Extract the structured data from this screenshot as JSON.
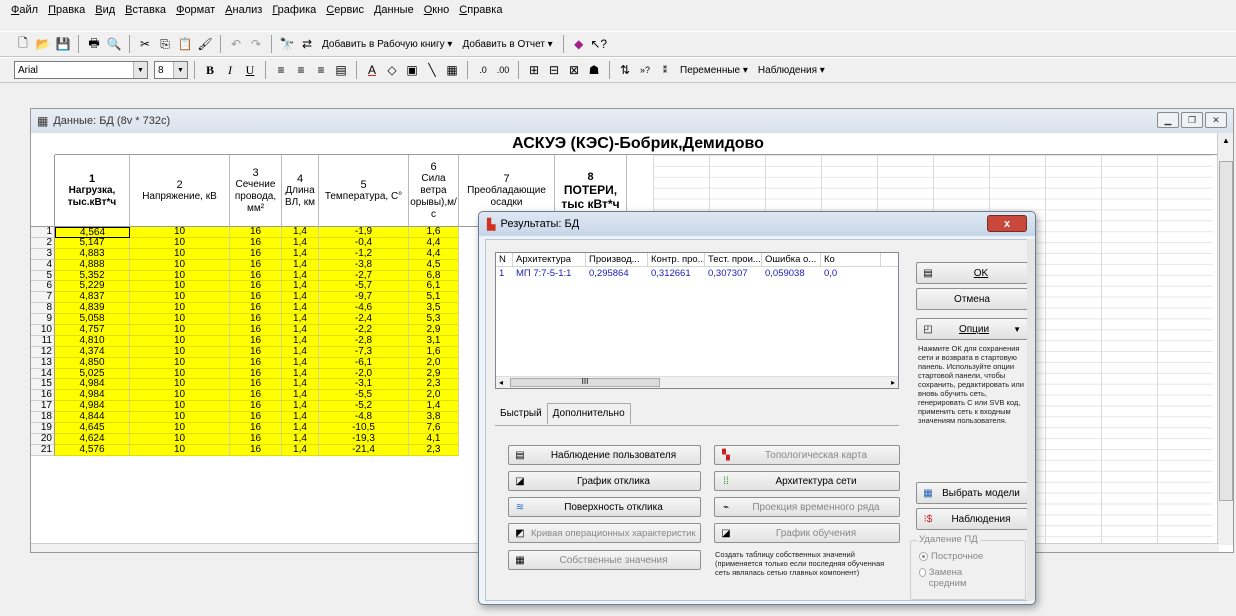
{
  "menu": [
    "Файл",
    "Правка",
    "Вид",
    "Вставка",
    "Формат",
    "Анализ",
    "Графика",
    "Сервис",
    "Данные",
    "Окно",
    "Справка"
  ],
  "toolbar1": {
    "add_workbook": "Добавить в Рабочую книгу ▾",
    "add_report": "Добавить в Отчет ▾"
  },
  "toolbar2": {
    "font": "Arial",
    "size": "8",
    "variables": "Переменные ▾",
    "observations": "Наблюдения ▾"
  },
  "data_window": {
    "title": "Данные: БД (8v * 732c)",
    "sheet_title": "АСКУЭ (КЭС)-Бобрик,Демидово",
    "columns": [
      {
        "num": "1",
        "label": "Нагрузка,\nтыс.кВт*ч",
        "bold": true
      },
      {
        "num": "2",
        "label": "Напряжение, кВ",
        "bold": false
      },
      {
        "num": "3",
        "label": "Сечение\nпровода,\nмм²",
        "bold": false
      },
      {
        "num": "4",
        "label": "Длина\nВЛ, км",
        "bold": false
      },
      {
        "num": "5",
        "label": "Температура, С°",
        "bold": false
      },
      {
        "num": "6",
        "label": "Сила\nветра\nорывы),м/с",
        "bold": false
      },
      {
        "num": "7",
        "label": "Преобладающие\nосадки",
        "bold": false
      },
      {
        "num": "8",
        "label": "ПОТЕРИ,\nтыс кВт*ч",
        "bold": true
      }
    ],
    "rows": [
      [
        "1",
        "4,564",
        "10",
        "16",
        "1,4",
        "-1,9",
        "1,6"
      ],
      [
        "2",
        "5,147",
        "10",
        "16",
        "1,4",
        "-0,4",
        "4,4"
      ],
      [
        "3",
        "4,883",
        "10",
        "16",
        "1,4",
        "-1,2",
        "4,4"
      ],
      [
        "4",
        "4,888",
        "10",
        "16",
        "1,4",
        "-3,8",
        "4,5"
      ],
      [
        "5",
        "5,352",
        "10",
        "16",
        "1,4",
        "-2,7",
        "6,8"
      ],
      [
        "6",
        "5,229",
        "10",
        "16",
        "1,4",
        "-5,7",
        "6,1"
      ],
      [
        "7",
        "4,837",
        "10",
        "16",
        "1,4",
        "-9,7",
        "5,1"
      ],
      [
        "8",
        "4,839",
        "10",
        "16",
        "1,4",
        "-4,6",
        "3,5"
      ],
      [
        "9",
        "5,058",
        "10",
        "16",
        "1,4",
        "-2,4",
        "5,3"
      ],
      [
        "10",
        "4,757",
        "10",
        "16",
        "1,4",
        "-2,2",
        "2,9"
      ],
      [
        "11",
        "4,810",
        "10",
        "16",
        "1,4",
        "-2,8",
        "3,1"
      ],
      [
        "12",
        "4,374",
        "10",
        "16",
        "1,4",
        "-7,3",
        "1,6"
      ],
      [
        "13",
        "4,850",
        "10",
        "16",
        "1,4",
        "-6,1",
        "2,0"
      ],
      [
        "14",
        "5,025",
        "10",
        "16",
        "1,4",
        "-2,0",
        "2,9"
      ],
      [
        "15",
        "4,984",
        "10",
        "16",
        "1,4",
        "-3,1",
        "2,3"
      ],
      [
        "16",
        "4,984",
        "10",
        "16",
        "1,4",
        "-5,5",
        "2,0"
      ],
      [
        "17",
        "4,984",
        "10",
        "16",
        "1,4",
        "-5,2",
        "1,4"
      ],
      [
        "18",
        "4,844",
        "10",
        "16",
        "1,4",
        "-4,8",
        "3,8"
      ],
      [
        "19",
        "4,645",
        "10",
        "16",
        "1,4",
        "-10,5",
        "7,6"
      ],
      [
        "20",
        "4,624",
        "10",
        "16",
        "1,4",
        "-19,3",
        "4,1"
      ],
      [
        "21",
        "4,576",
        "10",
        "16",
        "1,4",
        "-21,4",
        "2,3"
      ]
    ]
  },
  "results_dialog": {
    "title": "Результаты: БД",
    "close": "x",
    "table_headers": [
      "N",
      "Архитектура",
      "Производ...",
      "Контр. про...",
      "Тест. прои...",
      "Ошибка о...",
      "Ко"
    ],
    "table_rows": [
      [
        "1",
        "МП 7:7-5-1:1",
        "0,295864",
        "0,312661",
        "0,307307",
        "0,059038",
        "0,0"
      ]
    ],
    "scroll_mark": "III",
    "tab_quick": "Быстрый",
    "tab_advanced": "Дополнительно",
    "buttons": {
      "user_obs": "Наблюдение пользователя",
      "topo_map": "Топологическая карта",
      "response_graph": "График отклика",
      "net_arch": "Архитектура сети",
      "response_surface": "Поверхность отклика",
      "ts_projection": "Проекция временного ряда",
      "roc_curve": "Кривая операционных характеристик",
      "train_graph": "График обучения",
      "eigenvalues": "Собственные значения",
      "ok": "OK",
      "cancel": "Отмена",
      "options": "Опции",
      "select_models": "Выбрать модели",
      "observations": "Наблюдения"
    },
    "eigen_note": "Создать таблицу собственных значений (применяется только если последняя обученная сеть являлась сетью главных компонент)",
    "side_note": "Нажмите ОК для сохранения сети и возврата в стартовую панель. Используйте опции стартовой панели, чтобы сохранить, редактировать или вновь обучить сеть, генерировать С или SVB код, применить сеть к входным значениям пользователя.",
    "delete_group": "Удаление ПД",
    "radio_1": "Построчное",
    "radio_2": "Замена средним"
  }
}
